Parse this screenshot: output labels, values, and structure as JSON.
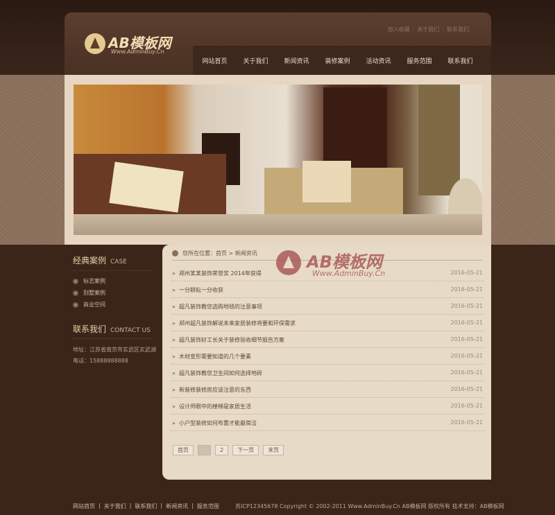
{
  "logo": {
    "text": "AB模板网",
    "sub": "Www.AdminBuy.Cn"
  },
  "toplinks": [
    "加入收藏",
    "关于我们",
    "联系我们"
  ],
  "nav": [
    "网站首页",
    "关于我们",
    "新闻资讯",
    "装修案例",
    "活动资讯",
    "服务范围",
    "联系我们"
  ],
  "sidebar": {
    "cases_title": "经典案例",
    "cases_title_en": "CASE",
    "cases": [
      "标志案例",
      "别墅案例",
      "商业空间"
    ],
    "contact_title": "联系我们",
    "contact_title_en": "CONTACT US",
    "address": "地址：江苏省南京市玄武区玄武湖",
    "phone": "电话：15888888888"
  },
  "crumb": "您所在位置：首页 > 新闻资讯",
  "news": [
    {
      "title": "郑州某某装饰荣誉奖 2014年获得",
      "date": "2016-05-21"
    },
    {
      "title": "一分耕耘一分收获",
      "date": "2016-05-21"
    },
    {
      "title": "超凡装饰教您选购地毯的注意事项",
      "date": "2016-05-21"
    },
    {
      "title": "郑州超凡装饰解说未来家居装修将要和环保需求",
      "date": "2016-05-21"
    },
    {
      "title": "超凡装饰好工长关于装修验收细节报告方案",
      "date": "2016-05-21"
    },
    {
      "title": "木材变形需要知道的几个要素",
      "date": "2016-05-21"
    },
    {
      "title": "超凡装饰教您卫生间如何选择地砖",
      "date": "2016-05-21"
    },
    {
      "title": "新装修装修房应该注意的东西",
      "date": "2016-05-21"
    },
    {
      "title": "设计师眼中的楼梯是家居生活",
      "date": "2016-05-21"
    },
    {
      "title": "小户型装修如何布置才能最简洁",
      "date": "2016-05-21"
    }
  ],
  "pager": {
    "first": "首页",
    "p1": "1",
    "p2": "2",
    "next": "下一页",
    "last": "末页"
  },
  "footer": {
    "links": [
      "网站首页",
      "|",
      "关于我们",
      "|",
      "联系我们",
      "|",
      "新闻资讯",
      "|",
      "服务范围"
    ],
    "copy": "苏ICP12345678  Copyright © 2002-2011 Www.AdminBuy.Cn AB模板网 版权所有  技术支持：AB模板网"
  },
  "watermark": {
    "text": "AB模板网",
    "sub": "Www.AdminBuy.Cn"
  }
}
